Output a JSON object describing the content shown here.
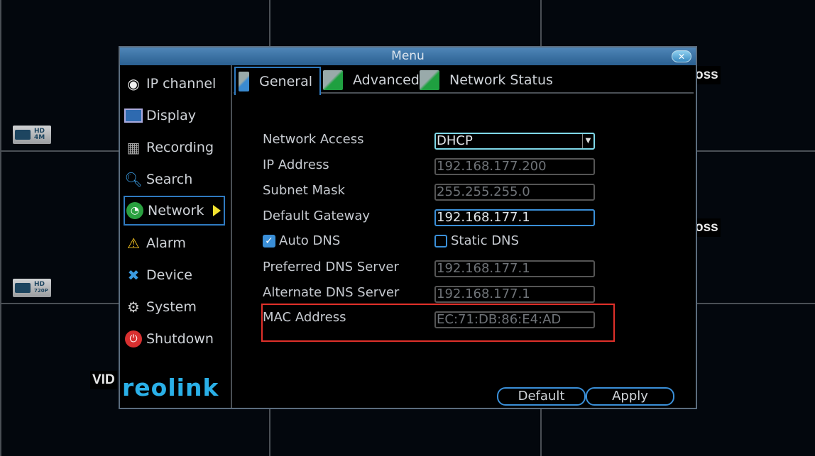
{
  "background": {
    "cameras": [
      {
        "hd": "HD",
        "res": "4M"
      },
      {
        "hd": "HD",
        "res": "720P"
      }
    ],
    "osd_texts": [
      "oss",
      "oss",
      "VID"
    ]
  },
  "dialog": {
    "title": "Menu",
    "close_icon": "close-icon",
    "sidebar": {
      "items": [
        {
          "label": "IP channel",
          "icon": "webcam-icon"
        },
        {
          "label": "Display",
          "icon": "display-icon"
        },
        {
          "label": "Recording",
          "icon": "film-gear-icon"
        },
        {
          "label": "Search",
          "icon": "magnifier-icon"
        },
        {
          "label": "Network",
          "icon": "network-icon",
          "active": true
        },
        {
          "label": "Alarm",
          "icon": "warning-icon"
        },
        {
          "label": "Device",
          "icon": "tools-icon"
        },
        {
          "label": "System",
          "icon": "gear-icon"
        },
        {
          "label": "Shutdown",
          "icon": "power-icon"
        }
      ],
      "logo": "reolink"
    },
    "tabs": [
      {
        "label": "General",
        "active": true
      },
      {
        "label": "Advanced"
      },
      {
        "label": "Network Status"
      }
    ],
    "form": {
      "network_access": {
        "label": "Network Access",
        "value": "DHCP"
      },
      "ip_address": {
        "label": "IP Address",
        "value": "192.168.177.200"
      },
      "subnet_mask": {
        "label": "Subnet Mask",
        "value": "255.255.255.0"
      },
      "default_gateway": {
        "label": "Default Gateway",
        "value": "192.168.177.1"
      },
      "auto_dns": {
        "label": "Auto DNS",
        "checked": true
      },
      "static_dns": {
        "label": "Static DNS",
        "checked": false
      },
      "preferred_dns": {
        "label": "Preferred DNS Server",
        "value": "192.168.177.1"
      },
      "alternate_dns": {
        "label": "Alternate DNS Server",
        "value": "192.168.177.1"
      },
      "mac_address": {
        "label": "MAC Address",
        "value": "EC:71:DB:86:E4:AD"
      }
    },
    "buttons": {
      "default": "Default",
      "apply": "Apply"
    },
    "colors": {
      "highlight": "#e0302a",
      "accent": "#3a8fd8",
      "title_bar": "#2a5f90"
    }
  }
}
